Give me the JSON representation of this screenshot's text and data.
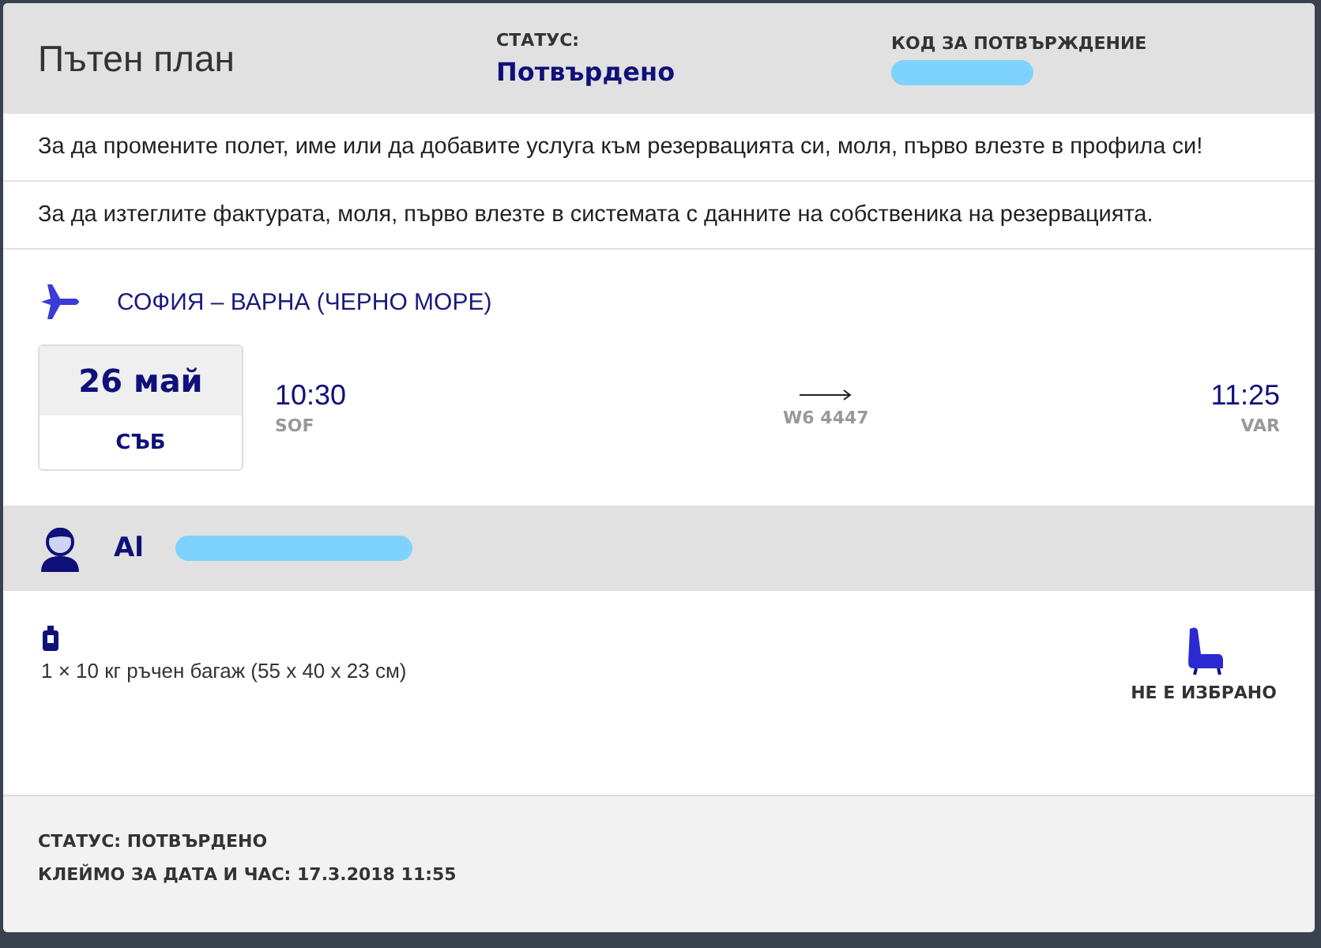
{
  "header": {
    "title": "Пътен план",
    "status_label": "СТАТУС:",
    "status_value": "Потвърдено",
    "code_label": "КОД ЗА ПОТВЪРЖДЕНИЕ"
  },
  "notices": [
    "За да промените полет, име или да добавите услуга към резервацията си, моля, първо влезте в профила си!",
    "За да изтеглите фактурата, моля, първо влезте в системата с данните на собственика на резервацията."
  ],
  "flight": {
    "route": "СОФИЯ – ВАРНА (ЧЕРНО МОРЕ)",
    "date": "26 май",
    "weekday": "СЪБ",
    "departure_time": "10:30",
    "departure_code": "SOF",
    "flight_number": "W6 4447",
    "arrival_time": "11:25",
    "arrival_code": "VAR"
  },
  "passenger": {
    "name": "Al"
  },
  "baggage": {
    "text": "1 × 10 кг ръчен багаж (55 x 40 x 23 см)"
  },
  "seat": {
    "text": "НЕ Е ИЗБРАНО"
  },
  "footer": [
    "СТАТУС: ПОТВЪРДЕНО",
    "КЛЕЙМО ЗА ДАТА И ЧАС: 17.3.2018 11:55"
  ]
}
